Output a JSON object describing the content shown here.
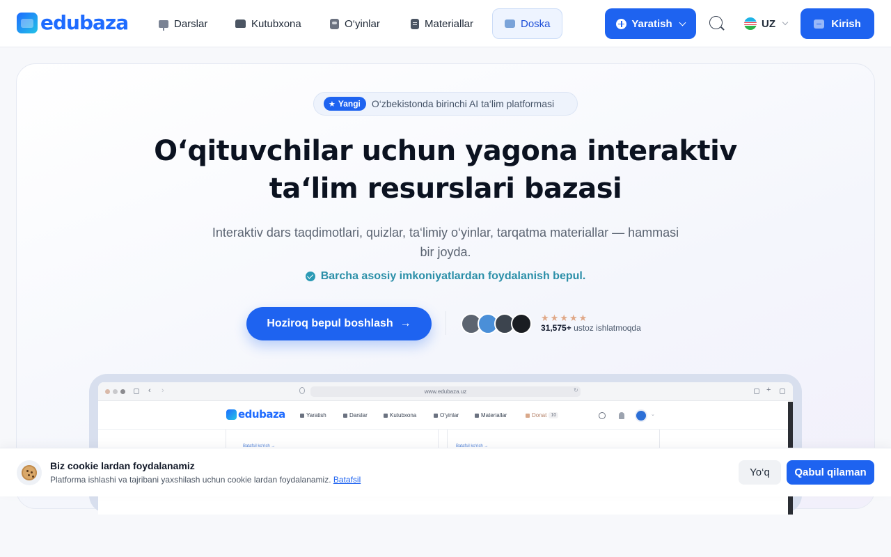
{
  "brand": {
    "logo_text": "edubaza",
    "accent": "#1e63f0"
  },
  "nav": {
    "items": [
      {
        "label": "Darslar",
        "icon": "presentation-icon"
      },
      {
        "label": "Kutubxona",
        "icon": "library-icon"
      },
      {
        "label": "O‘yinlar",
        "icon": "gamepad-icon"
      },
      {
        "label": "Materiallar",
        "icon": "document-icon"
      },
      {
        "label": "Doska",
        "icon": "whiteboard-icon",
        "active": true
      }
    ],
    "create_label": "Yaratish",
    "language": "UZ",
    "login_label": "Kirish"
  },
  "hero": {
    "badge_pill": "Yangi",
    "badge_text": "O‘zbekistonda birinchi AI ta‘lim platformasi",
    "headline_line1": "O‘qituvchilar uchun yagona interaktiv",
    "headline_line2": "ta‘lim resurslari bazasi",
    "subtext": "Interaktiv dars taqdimotlari, quizlar, ta‘limiy o‘yinlar, tarqatma materiallar — hammasi bir joyda.",
    "free_note": "Barcha asosiy imkoniyatlardan foydalanish bepul.",
    "cta_label": "Hoziroq bepul boshlash",
    "rating_stars": 5,
    "user_count": "31,575+",
    "user_suffix": "ustoz ishlatmoqda"
  },
  "mockup": {
    "url": "www.edubaza.uz",
    "logo_text": "edubaza",
    "nav": [
      "Yaratish",
      "Darslar",
      "Kutubxona",
      "O‘yinlar",
      "Materiallar",
      "Donat"
    ],
    "donat_count": "10",
    "card_link": "Batafsil ko‘rish →"
  },
  "cookie": {
    "title": "Biz cookie lardan foydalanamiz",
    "text": "Platforma ishlashi va tajribani yaxshilash uchun cookie lardan foydalanamiz.",
    "link": "Batafsil",
    "decline": "Yo‘q",
    "accept": "Qabul qilaman"
  }
}
